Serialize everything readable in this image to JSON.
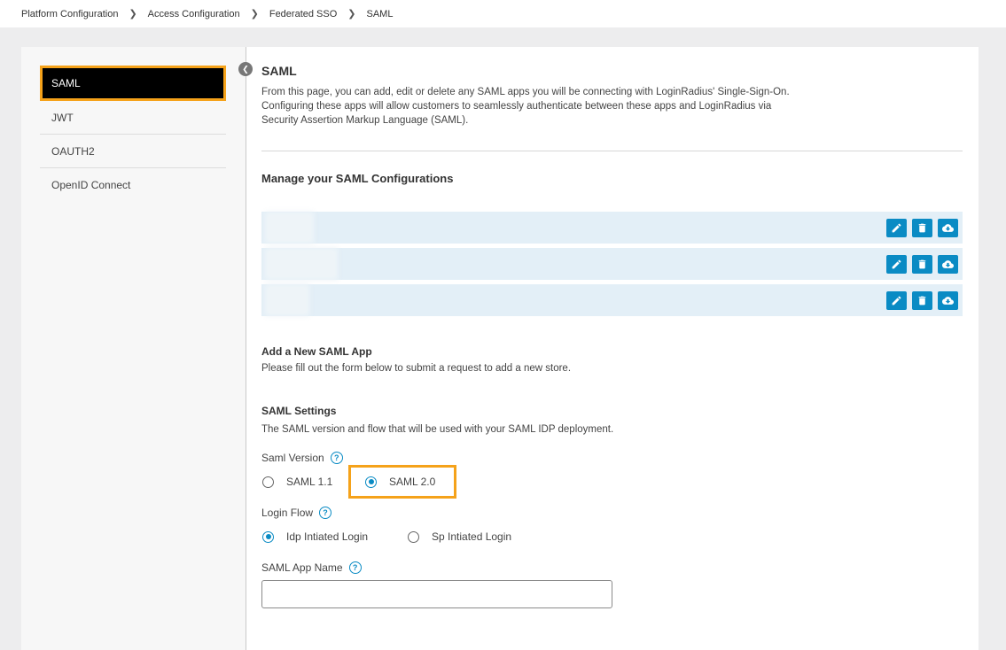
{
  "breadcrumb": [
    "Platform Configuration",
    "Access Configuration",
    "Federated SSO",
    "SAML"
  ],
  "sidebar": {
    "items": [
      {
        "label": "SAML",
        "active": true
      },
      {
        "label": "JWT"
      },
      {
        "label": "OAUTH2"
      },
      {
        "label": "OpenID Connect"
      }
    ]
  },
  "main": {
    "title": "SAML",
    "description_lines": [
      "From this page, you can add, edit or delete any SAML apps you will be connecting with LoginRadius' Single-Sign-On.",
      "Configuring these apps will allow customers to seamlessly authenticate between these apps and LoginRadius via",
      "Security Assertion Markup Language (SAML)."
    ],
    "manage_title": "Manage your SAML Configurations",
    "app_rows": 3,
    "add_title": "Add a New SAML App",
    "add_desc": "Please fill out the form below to submit a request to add a new store.",
    "settings_title": "SAML Settings",
    "settings_desc": "The SAML version and flow that will be used with your SAML IDP deployment.",
    "saml_version": {
      "label": "Saml Version",
      "options": [
        {
          "label": "SAML 1.1",
          "checked": false
        },
        {
          "label": "SAML 2.0",
          "checked": true
        }
      ]
    },
    "login_flow": {
      "label": "Login Flow",
      "options": [
        {
          "label": "Idp Intiated Login",
          "checked": true
        },
        {
          "label": "Sp Intiated Login",
          "checked": false
        }
      ]
    },
    "app_name": {
      "label": "SAML App Name",
      "value": ""
    }
  },
  "colors": {
    "accent": "#0a8bc4",
    "highlight": "#f5a21a",
    "row_bg": "#e3eff7"
  }
}
